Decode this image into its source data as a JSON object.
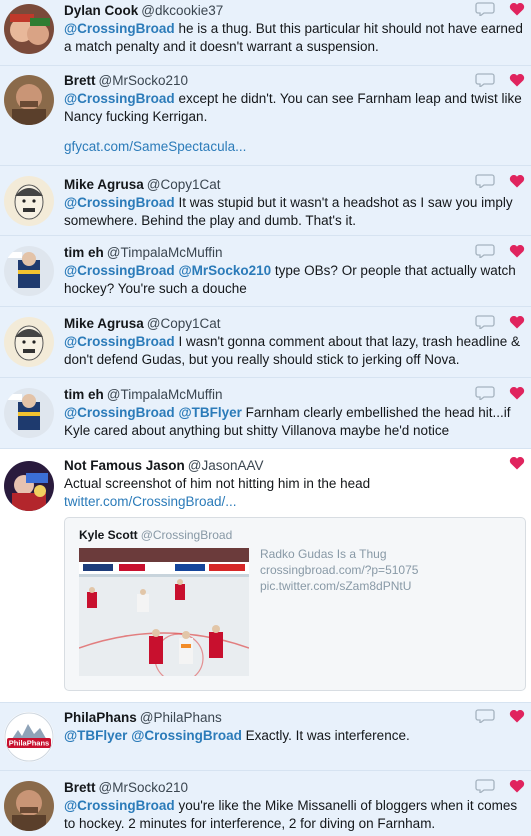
{
  "tweets": [
    {
      "name": "Dylan Cook",
      "handle": "@dkcookie37",
      "mention": "@CrossingBroad",
      "mention2": "",
      "text": " he is a thug. But this particular hit should not have earned a match penalty and it doesn't warrant a suspension.",
      "link": ""
    },
    {
      "name": "Brett",
      "handle": "@MrSocko210",
      "mention": "@CrossingBroad",
      "mention2": "",
      "text": " except he didn't.  You can see Farnham leap and twist like Nancy fucking Kerrigan.",
      "link": "gfycat.com/SameSpectacula..."
    },
    {
      "name": "Mike Agrusa",
      "handle": "@Copy1Cat",
      "mention": "@CrossingBroad",
      "mention2": "",
      "text": " It was stupid but it wasn't a headshot as I saw you imply somewhere. Behind the play and dumb. That's it.",
      "link": ""
    },
    {
      "name": "tim eh",
      "handle": "@TimpalaMcMuffin",
      "mention": "@CrossingBroad",
      "mention2": "@MrSocko210",
      "text": " type OBs? Or people that actually watch hockey? You're such a douche",
      "link": ""
    },
    {
      "name": "Mike Agrusa",
      "handle": "@Copy1Cat",
      "mention": "@CrossingBroad",
      "mention2": "",
      "text": " I wasn't gonna comment about that lazy, trash headline & don't defend Gudas, but you really should stick to jerking off Nova.",
      "link": ""
    },
    {
      "name": "tim eh",
      "handle": "@TimpalaMcMuffin",
      "mention": "@CrossingBroad",
      "mention2": "@TBFlyer",
      "text": " Farnham clearly embellished the head hit...if Kyle cared about anything but shitty Villanova maybe he'd notice",
      "link": ""
    },
    {
      "name": "Not Famous Jason",
      "handle": "@JasonAAV",
      "mention": "",
      "mention2": "",
      "text": "Actual screenshot of him not hitting him in the head ",
      "link": "twitter.com/CrossingBroad/..."
    },
    {
      "name": "PhilaPhans",
      "handle": "@PhilaPhans",
      "mention": "@TBFlyer",
      "mention2": "@CrossingBroad",
      "text": " Exactly. It was interference.",
      "link": ""
    },
    {
      "name": "Brett",
      "handle": "@MrSocko210",
      "mention": "@CrossingBroad",
      "mention2": "",
      "text": " you're like the Mike Missanelli of bloggers when it comes to hockey.  2 minutes for interference, 2 for diving on Farnham.",
      "link": ""
    }
  ],
  "quote": {
    "name": "Kyle Scott",
    "handle": "@CrossingBroad",
    "line1": "Radko Gudas Is a Thug",
    "line2": "crossingbroad.com/?p=51075",
    "line3": "pic.twitter.com/sZam8dPNtU"
  },
  "avatar_labels": {
    "philaphans": "PhilaPhans"
  },
  "colors": {
    "link": "#2b7bb9",
    "like": "#e0245e",
    "highlight_bg": "#e8f1fb"
  },
  "icons": {
    "reply": "reply-icon",
    "like": "heart-icon"
  }
}
